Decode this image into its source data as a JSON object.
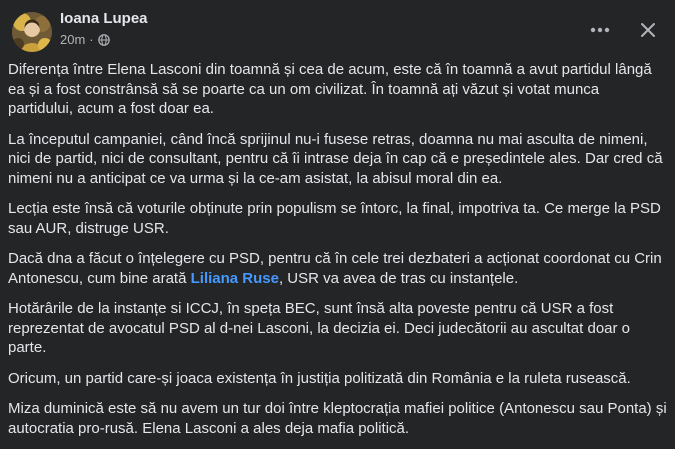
{
  "post": {
    "author": "Ioana Lupea",
    "time": "20m",
    "separator": "·",
    "icons": {
      "avatar": "profile-photo",
      "privacy": "globe-icon",
      "more": "more-horizontal-icon",
      "close": "close-icon"
    },
    "paragraphs": [
      "Diferența între Elena Lasconi din toamnă și cea de acum, este că în toamnă a avut partidul lângă ea și a fost constrânsă să se poarte ca un om civilizat. În toamnă ați văzut și votat munca partidului, acum a fost doar ea.",
      "La începutul campaniei, când încă sprijinul nu-i fusese retras, doamna nu mai asculta de nimeni, nici de partid, nici de consultant, pentru că îi intrase deja în cap că e președintele ales.  Dar cred că nimeni nu a anticipat ce va urma și la ce-am asistat, la abisul moral din ea.",
      "Lecția este însă că voturile obținute prin populism se întorc, la final, impotriva ta. Ce merge la PSD sau AUR, distruge USR.",
      "",
      "Hotărârile de la instanțe si ICCJ, în speța BEC, sunt însă alta poveste pentru că USR a fost reprezentat de avocatul PSD al d-nei Lasconi, la decizia ei. Deci judecătorii au ascultat doar o parte.",
      "Oricum, un partid care-și joaca existența în justiția politizată din România e la ruleta rusească.",
      "Miza duminică este să nu avem un tur doi între kleptocrația mafiei politice (Antonescu sau Ponta) și autocratia pro-rusă. Elena Lasconi a ales deja mafia politică."
    ],
    "mention_paragraph": {
      "before": "Dacă dna a făcut o înțelegere cu PSD, pentru că în cele trei dezbateri a acționat coordonat cu Crin Antonescu, cum bine arată ",
      "mention": "Liliana Ruse",
      "after": ", USR va avea de tras cu instanțele."
    }
  }
}
